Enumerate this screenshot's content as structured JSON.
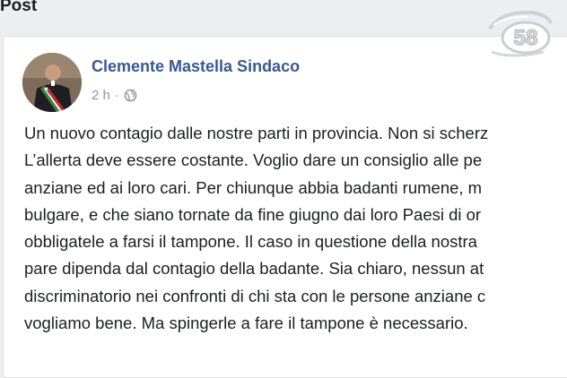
{
  "section": {
    "title": "Post"
  },
  "post": {
    "author": "Clemente Mastella Sindaco",
    "time": "2 h",
    "separator": "·",
    "privacy_icon": "globe-icon",
    "lines": [
      "Un nuovo contagio dalle nostre parti in provincia. Non si scherz",
      "L’allerta deve essere costante. Voglio dare un consiglio alle pe",
      "anziane ed ai loro cari. Per chiunque abbia badanti rumene, m",
      "bulgare, e che siano tornate da fine giugno dai loro Paesi di or",
      "obbligatele a farsi il tampone. Il caso in questione della nostra",
      "pare dipenda dal contagio della badante. Sia chiaro, nessun at",
      "discriminatorio nei confronti di chi sta con le persone anziane c",
      "vogliamo bene. Ma spingerle a fare il tampone è necessario."
    ]
  },
  "watermark": {
    "text": "58"
  },
  "colors": {
    "author": "#385898",
    "text": "#1c1e21",
    "meta": "#90949c",
    "background": "#eceef1"
  }
}
